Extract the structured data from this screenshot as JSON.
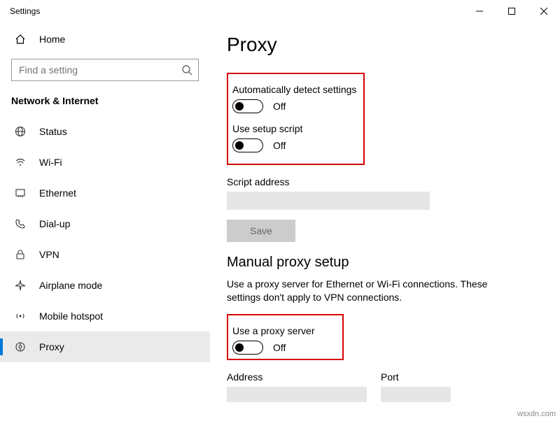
{
  "window": {
    "title": "Settings"
  },
  "sidebar": {
    "home": "Home",
    "search_placeholder": "Find a setting",
    "section": "Network & Internet",
    "items": [
      {
        "label": "Status"
      },
      {
        "label": "Wi-Fi"
      },
      {
        "label": "Ethernet"
      },
      {
        "label": "Dial-up"
      },
      {
        "label": "VPN"
      },
      {
        "label": "Airplane mode"
      },
      {
        "label": "Mobile hotspot"
      },
      {
        "label": "Proxy"
      }
    ]
  },
  "main": {
    "title": "Proxy",
    "auto_detect_label": "Automatically detect settings",
    "auto_detect_state": "Off",
    "use_script_label": "Use setup script",
    "use_script_state": "Off",
    "script_address_label": "Script address",
    "script_address_value": "",
    "save_label": "Save",
    "manual_heading": "Manual proxy setup",
    "manual_desc": "Use a proxy server for Ethernet or Wi-Fi connections. These settings don't apply to VPN connections.",
    "use_proxy_label": "Use a proxy server",
    "use_proxy_state": "Off",
    "address_label": "Address",
    "address_value": "",
    "port_label": "Port",
    "port_value": ""
  },
  "watermark": "wsxdn.com"
}
